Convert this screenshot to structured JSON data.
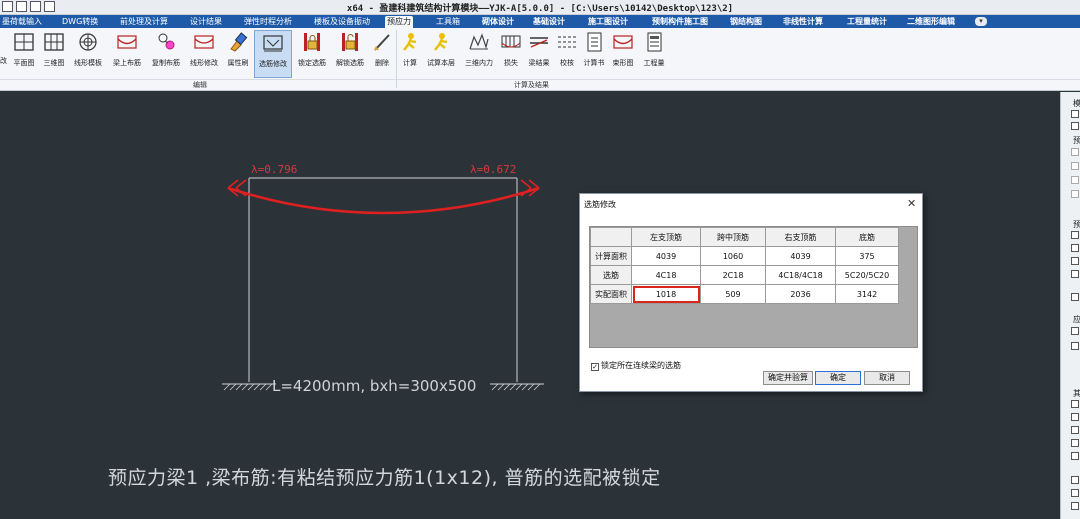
{
  "window": {
    "title": "x64 - 盈建科建筑结构计算模块——YJK-A[5.0.0] - [C:\\Users\\10142\\Desktop\\123\\2]"
  },
  "tabs": [
    {
      "label": "墨荷载输入",
      "bold": true
    },
    {
      "label": "DWG转换",
      "bold": true
    },
    {
      "label": "前处理及计算",
      "bold": false
    },
    {
      "label": "设计结果",
      "bold": false
    },
    {
      "label": "弹性时程分析",
      "bold": false
    },
    {
      "label": "楼板及设备振动",
      "bold": false
    },
    {
      "label": "预应力",
      "bold": false,
      "active": true
    },
    {
      "label": "工具箱",
      "bold": false
    },
    {
      "label": "砌体设计",
      "bold": true
    },
    {
      "label": "基础设计",
      "bold": true
    },
    {
      "label": "施工图设计",
      "bold": true
    },
    {
      "label": "预制构件施工图",
      "bold": true
    },
    {
      "label": "钢结构图",
      "bold": true
    },
    {
      "label": "非线性计算",
      "bold": true
    },
    {
      "label": "工程量统计",
      "bold": true
    },
    {
      "label": "二维图形编辑",
      "bold": true
    }
  ],
  "ribbon": {
    "edge_label": "改",
    "buttons": [
      {
        "label": "平面图",
        "icon": "plan-view-icon"
      },
      {
        "label": "三维图",
        "icon": "3d-view-icon"
      },
      {
        "label": "线形模板",
        "icon": "line-template-icon"
      },
      {
        "label": "梁上布筋",
        "icon": "beam-reinforce-icon"
      },
      {
        "label": "复制布筋",
        "icon": "copy-reinforce-icon"
      },
      {
        "label": "线形修改",
        "icon": "line-modify-icon"
      },
      {
        "label": "属性刷",
        "icon": "property-brush-icon"
      },
      {
        "label": "选筋修改",
        "icon": "rebar-modify-icon",
        "selected": true
      },
      {
        "label": "锁定选筋",
        "icon": "lock-rebar-icon"
      },
      {
        "label": "解锁选筋",
        "icon": "unlock-rebar-icon"
      },
      {
        "label": "删除",
        "icon": "delete-icon"
      },
      {
        "label": "计算",
        "icon": "calculate-icon"
      },
      {
        "label": "试算本层",
        "icon": "trial-calc-icon"
      },
      {
        "label": "三维内力",
        "icon": "3d-force-icon"
      },
      {
        "label": "损失",
        "icon": "loss-icon"
      },
      {
        "label": "梁结果",
        "icon": "beam-result-icon"
      },
      {
        "label": "校核",
        "icon": "check-icon"
      },
      {
        "label": "计算书",
        "icon": "report-icon"
      },
      {
        "label": "束形图",
        "icon": "tendon-shape-icon"
      },
      {
        "label": "工程量",
        "icon": "quantity-icon"
      }
    ],
    "groups": {
      "edit": "编辑",
      "calc": "计算及结果"
    }
  },
  "canvas": {
    "left_label": "λ=0.796",
    "right_label": "λ=0.672",
    "dimension": "L=4200mm, bxh=300x500",
    "caption": "预应力梁1 ,梁布筋:有粘结预应力筋1(1x12), 普筋的选配被锁定"
  },
  "dialog": {
    "title": "选筋修改",
    "columns": [
      "",
      "左支顶筋",
      "跨中顶筋",
      "右支顶筋",
      "底筋"
    ],
    "rows": [
      {
        "label": "计算面积",
        "values": [
          "4039",
          "1060",
          "4039",
          "375"
        ]
      },
      {
        "label": "选筋",
        "values": [
          "4C18",
          "2C18",
          "4C18/4C18",
          "5C20/5C20"
        ]
      },
      {
        "label": "实配面积",
        "values": [
          "1018",
          "509",
          "2036",
          "3142"
        ]
      }
    ],
    "lock_checkbox": {
      "label": "锁定所在连续梁的选筋",
      "checked": true
    },
    "buttons": {
      "confirm_check": "确定并验算",
      "ok": "确定",
      "cancel": "取消"
    }
  },
  "right_panel": {
    "labels": [
      "模",
      "预",
      "预",
      "应",
      "其"
    ]
  },
  "colors": {
    "canvas_bg": "#2b3339",
    "tab_bar": "#1f5aa8",
    "tendon": "#e02020",
    "highlight_box": "#d9261c"
  }
}
